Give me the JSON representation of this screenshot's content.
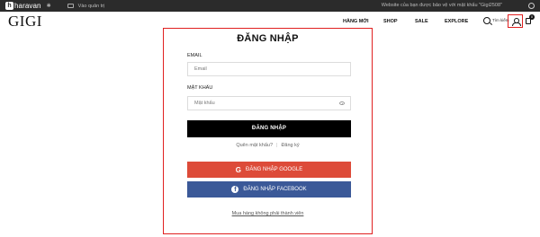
{
  "admin_bar": {
    "brand": "haravan",
    "link_label": "Vào quản trị",
    "message": "Website của bạn được bảo vệ với mật khẩu \"Gigi2508\""
  },
  "header": {
    "logo": "GIGI",
    "nav": [
      "HÀNG MỚI",
      "SHOP",
      "SALE",
      "EXPLORE"
    ],
    "search_label": "Tìm kiếm",
    "cart_count": "0"
  },
  "login": {
    "title": "ĐĂNG NHẬP",
    "email_label": "EMAIL",
    "email_placeholder": "Email",
    "password_label": "MẬT KHẨU",
    "password_placeholder": "Mật khẩu",
    "submit_label": "ĐĂNG NHẬP",
    "forgot_label": "Quên mật khẩu?",
    "register_label": "Đăng ký",
    "google_label": "ĐĂNG NHẬP GOOGLE",
    "facebook_label": "ĐĂNG NHẬP FACEBOOK",
    "guest_label": "Mua hàng không phải thành viên"
  },
  "colors": {
    "highlight": "#e02020",
    "google": "#dd4b39",
    "facebook": "#3b5998",
    "primary_button": "#000000"
  }
}
